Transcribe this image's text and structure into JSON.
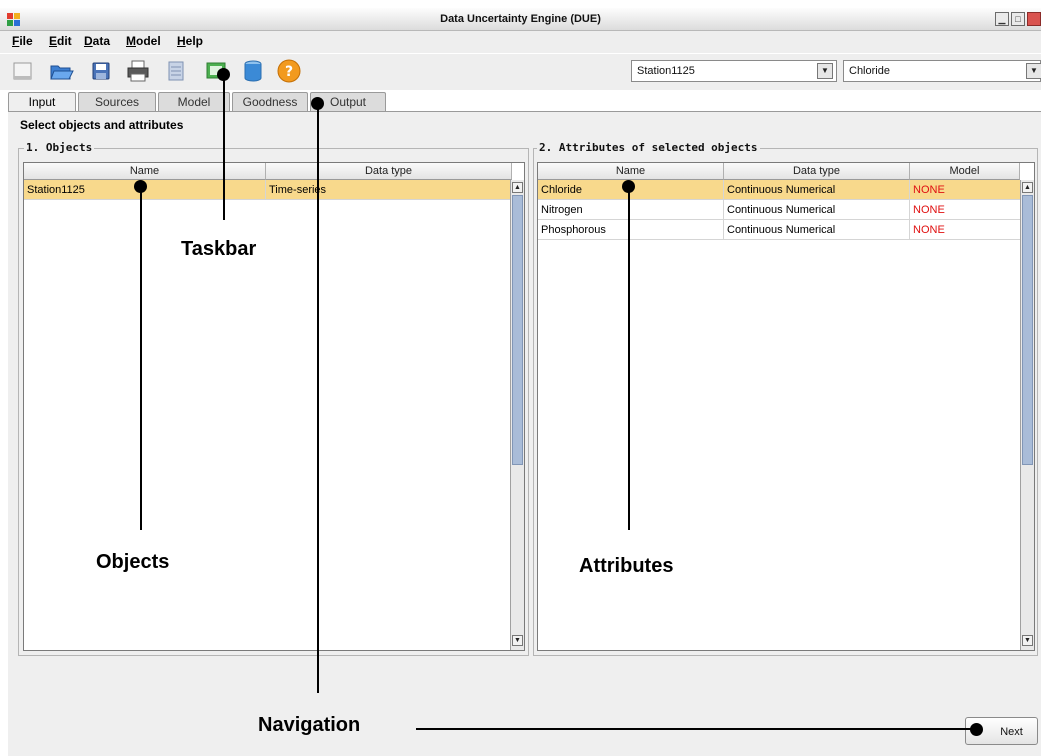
{
  "window": {
    "title": "Data Uncertainty Engine (DUE)"
  },
  "menu": [
    {
      "label": "File",
      "mnemonic": "F",
      "rest": "ile"
    },
    {
      "label": "Edit",
      "mnemonic": "E",
      "rest": "dit"
    },
    {
      "label": "Data",
      "mnemonic": "D",
      "rest": "ata"
    },
    {
      "label": "Model",
      "mnemonic": "M",
      "rest": "odel"
    },
    {
      "label": "Help",
      "mnemonic": "H",
      "rest": "elp"
    }
  ],
  "toolbar": {
    "icons": [
      "new-file-icon",
      "open-folder-icon",
      "save-disk-icon",
      "print-icon",
      "database-icon",
      "import-data-icon",
      "cylinder-database-icon",
      "help-icon"
    ],
    "object_combo": {
      "value": "Station1125"
    },
    "attribute_combo": {
      "value": "Chloride"
    }
  },
  "tabs": [
    {
      "label": "Input",
      "active": true
    },
    {
      "label": "Sources",
      "active": false
    },
    {
      "label": "Model",
      "active": false
    },
    {
      "label": "Goodness",
      "active": false
    },
    {
      "label": "Output",
      "active": false
    }
  ],
  "panel": {
    "heading": "Select objects and attributes",
    "objects": {
      "title": "1. Objects",
      "columns": [
        "Name",
        "Data type"
      ],
      "rows": [
        {
          "name": "Station1125",
          "data_type": "Time-series",
          "selected": true
        }
      ]
    },
    "attributes": {
      "title": "2. Attributes of selected objects",
      "columns": [
        "Name",
        "Data type",
        "Model"
      ],
      "rows": [
        {
          "name": "Chloride",
          "data_type": "Continuous Numerical",
          "model": "NONE",
          "selected": true
        },
        {
          "name": "Nitrogen",
          "data_type": "Continuous Numerical",
          "model": "NONE",
          "selected": false
        },
        {
          "name": "Phosphorous",
          "data_type": "Continuous Numerical",
          "model": "NONE",
          "selected": false
        }
      ]
    }
  },
  "navigation": {
    "next_label": "Next"
  },
  "annotations": {
    "taskbar": "Taskbar",
    "objects": "Objects",
    "attributes": "Attributes",
    "navigation": "Navigation"
  },
  "colors": {
    "selection": "#f8d98c",
    "model_none": "#e01010",
    "scroll_thumb": "#a9bcd8"
  }
}
